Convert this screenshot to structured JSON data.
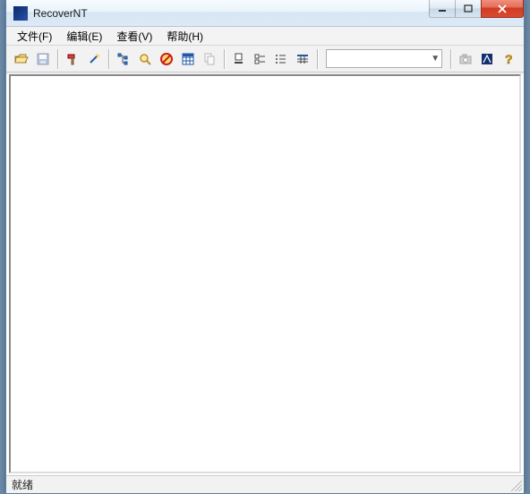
{
  "window": {
    "title": "RecoverNT"
  },
  "menu": {
    "file": "文件(F)",
    "edit": "编辑(E)",
    "view": "查看(V)",
    "help": "帮助(H)"
  },
  "toolbar": {
    "open": "open",
    "save": "save",
    "tool_hammer": "configure",
    "tool_wand": "process",
    "tree": "tree-view",
    "find": "find",
    "stop": "stop",
    "grid": "grid",
    "copy": "copy",
    "large_icons": "large-icons",
    "small_icons": "small-icons",
    "list": "list",
    "details": "details",
    "dropdown_value": "",
    "camera": "camera",
    "app": "app",
    "help": "help"
  },
  "status": {
    "text": "就绪"
  }
}
